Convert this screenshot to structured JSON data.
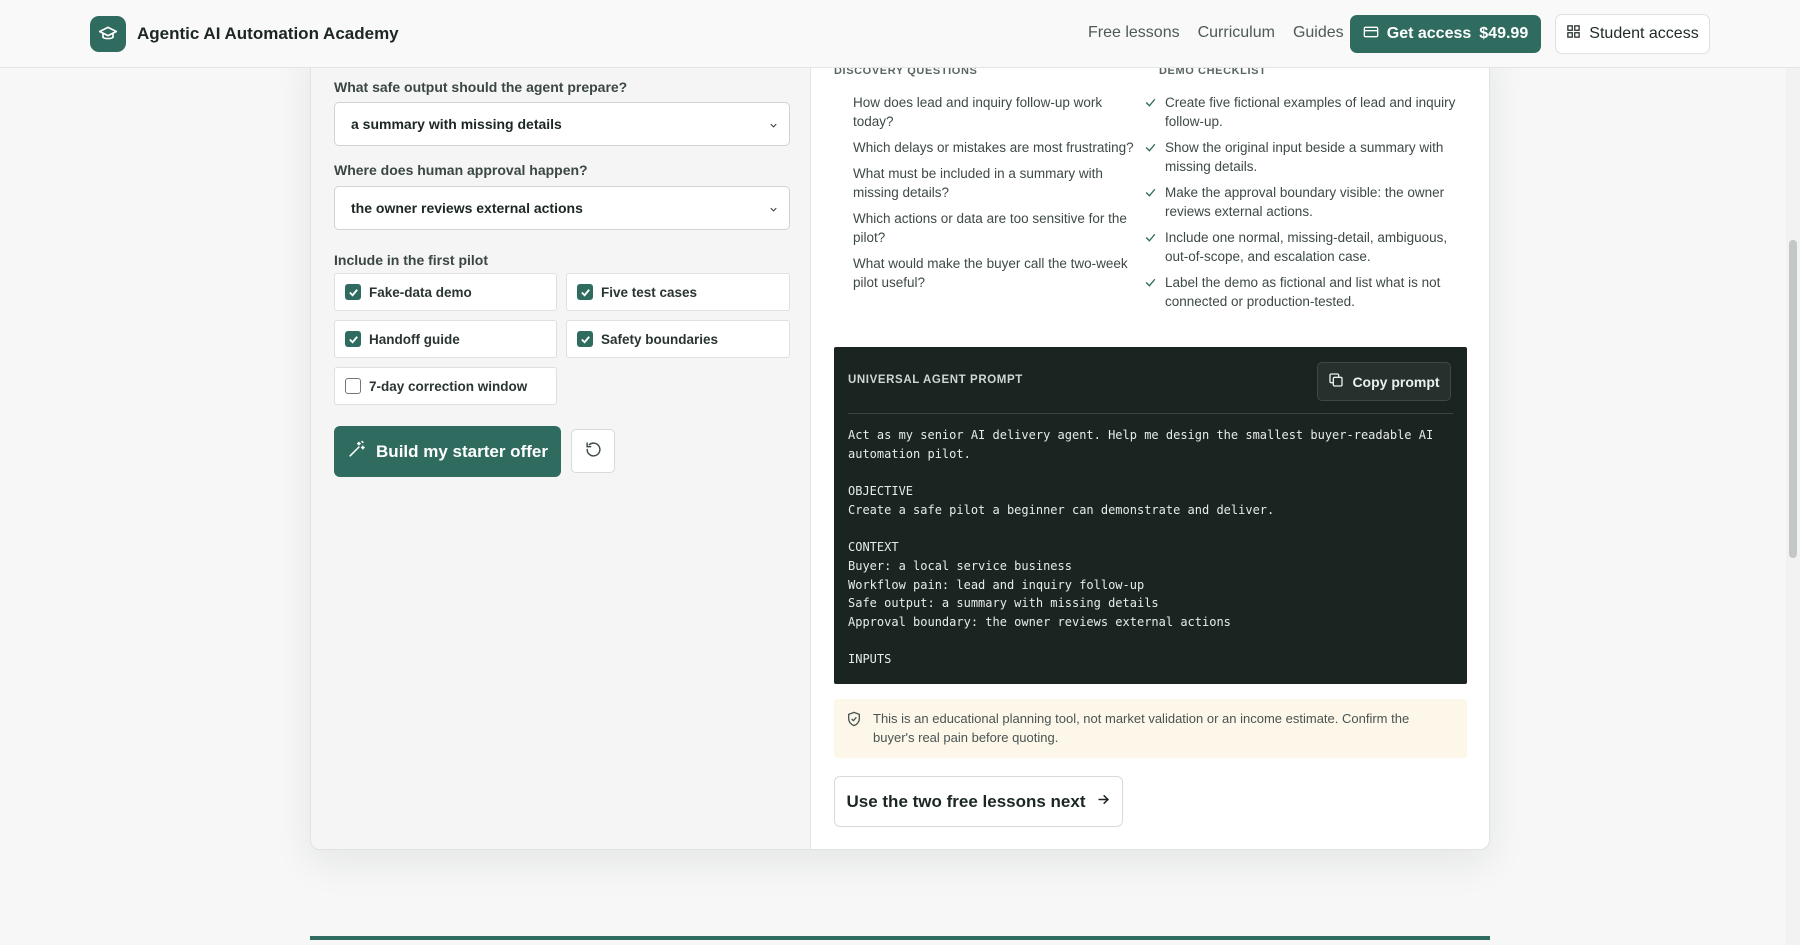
{
  "header": {
    "brand_name": "Agentic AI Automation Academy",
    "nav": [
      "Free lessons",
      "Curriculum",
      "Guides"
    ],
    "access_label": "Get access",
    "access_price": "$49.99",
    "student_label": "Student access"
  },
  "form": {
    "output_label": "What safe output should the agent prepare?",
    "output_value": "a summary with missing details",
    "approval_label": "Where does human approval happen?",
    "approval_value": "the owner reviews external actions",
    "include_label": "Include in the first pilot",
    "checks": [
      {
        "label": "Fake-data demo",
        "checked": true
      },
      {
        "label": "Five test cases",
        "checked": true
      },
      {
        "label": "Handoff guide",
        "checked": true
      },
      {
        "label": "Safety boundaries",
        "checked": true
      },
      {
        "label": "7-day correction window",
        "checked": false
      }
    ],
    "build_label": "Build my starter offer"
  },
  "result": {
    "questions_heading": "Discovery questions",
    "questions": [
      "How does lead and inquiry follow-up work today?",
      "Which delays or mistakes are most frustrating?",
      "What must be included in a summary with missing details?",
      "Which actions or data are too sensitive for the pilot?",
      "What would make the buyer call the two-week pilot useful?"
    ],
    "checklist_heading": "Demo checklist",
    "checklist": [
      "Create five fictional examples of lead and inquiry follow-up.",
      "Show the original input beside a summary with missing details.",
      "Make the approval boundary visible: the owner reviews external actions.",
      "Include one normal, missing-detail, ambiguous, out-of-scope, and escalation case.",
      "Label the demo as fictional and list what is not connected or production-tested."
    ],
    "prompt_title": "UNIVERSAL AGENT PROMPT",
    "copy_label": "Copy prompt",
    "prompt_text": "Act as my senior AI delivery agent. Help me design the smallest buyer-readable AI automation pilot.\n\nOBJECTIVE\nCreate a safe pilot a beginner can demonstrate and deliver.\n\nCONTEXT\nBuyer: a local service business\nWorkflow pain: lead and inquiry follow-up\nSafe output: a summary with missing details\nApproval boundary: the owner reviews external actions\n\nINPUTS",
    "notice": "This is an educational planning tool, not market validation or an income estimate. Confirm the buyer's real pain before quoting.",
    "next_label": "Use the two free lessons next"
  },
  "colors": {
    "accent": "#2f6b5e",
    "prompt_bg": "#1a2420",
    "notice_bg": "#fdf7ea"
  }
}
